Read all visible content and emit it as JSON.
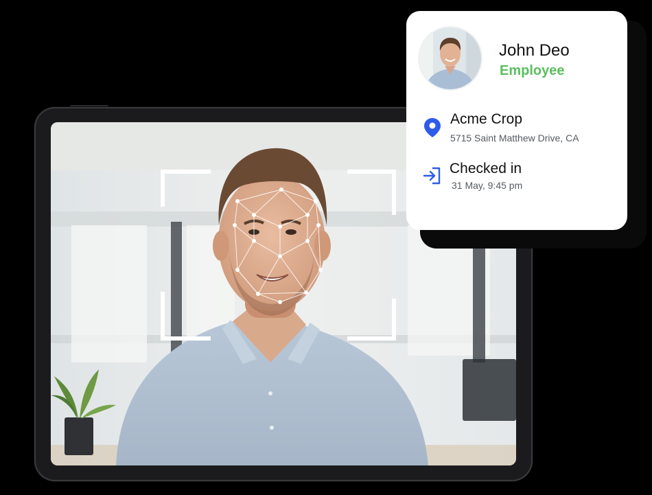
{
  "profile_card": {
    "name": "John Deo",
    "role": "Employee",
    "role_color": "#5bbf5f",
    "avatar_icon": "person-avatar",
    "location": {
      "icon": "map-pin-icon",
      "icon_color": "#2f5bea",
      "title": "Acme Crop",
      "address": "5715 Saint Matthew Drive, CA"
    },
    "check_in": {
      "icon": "sign-in-icon",
      "icon_color": "#2f5bea",
      "status": "Checked in",
      "time": "31 May, 9:45 pm"
    }
  },
  "tablet": {
    "content": "face-scan-camera-view",
    "overlay": "face-mesh-with-corner-brackets"
  }
}
